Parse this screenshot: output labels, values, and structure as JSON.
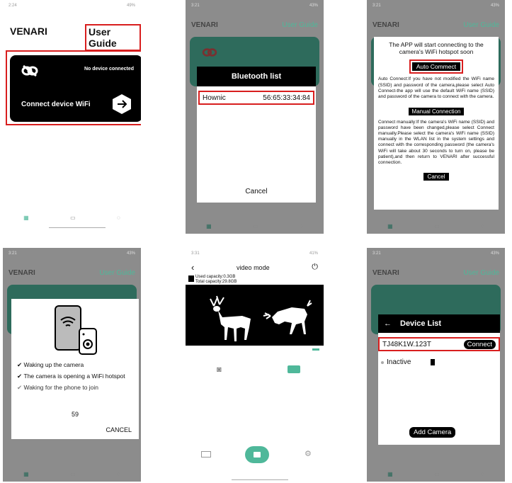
{
  "p1": {
    "time": "2:24",
    "status_right": "49%",
    "brand": "VENARI",
    "guide": "User Guide",
    "no_device": "No device connected",
    "connect_label": "Connect device WiFi"
  },
  "p2": {
    "time": "3:21",
    "status_right": "43%",
    "brand": "VENARI",
    "guide": "User Guide",
    "dialog_title": "Bluetooth list",
    "device_name": "Hownic",
    "device_mac": "56:65:33:34:84",
    "cancel": "Cancel"
  },
  "p3": {
    "time": "3:21",
    "status_right": "43%",
    "brand": "VENARI",
    "guide": "User Guide",
    "intro": "The APP will start connecting to the camera's WiFi hotspot soon",
    "auto_btn": "Auto Commect",
    "auto_text": "Auto Connect:If you have not modified the WiFi name (SSID) and password of the camera,please select Auto Connect-the app will use the default WiFi name (SSID) and password of the camera to connect with the camera.",
    "manual_btn": "Manual Connection",
    "manual_text": "Connect manually:If the camera's WiFi name (SSID) and password have been changed,please select Connect manually.Please select the camera's WiFi name (SSID) manually in the WLAN list in the system settings and connect with the corresponding password (the camera's WiFi will take about 30 seconds to turn on, please be patient),and then return to VENARI after successful connection.",
    "cancel": "Cancel"
  },
  "p4": {
    "time": "3:21",
    "status_right": "43%",
    "brand": "VENARI",
    "guide": "User Guide",
    "step1": "Waking up the camera",
    "step2": "The camera is opening a WiFi hotspot",
    "step3": "Waking for the phone to join",
    "countdown": "59",
    "cancel": "CANCEL"
  },
  "p5": {
    "time": "3:31",
    "status_right": "41%",
    "title": "video mode",
    "used": "Used capacity:0.3GB",
    "total": "Total capacity:29.8GB"
  },
  "p6": {
    "time": "3:21",
    "status_right": "43%",
    "brand": "VENARI",
    "guide": "User Guide",
    "list_title": "Device List",
    "device_name": "TJ48K1W.123T",
    "connect": "Connect",
    "inactive": "Inactive",
    "add_camera": "Add Camera"
  },
  "colors": {
    "accent": "#4fb89a",
    "highlight": "#d81e1e"
  }
}
